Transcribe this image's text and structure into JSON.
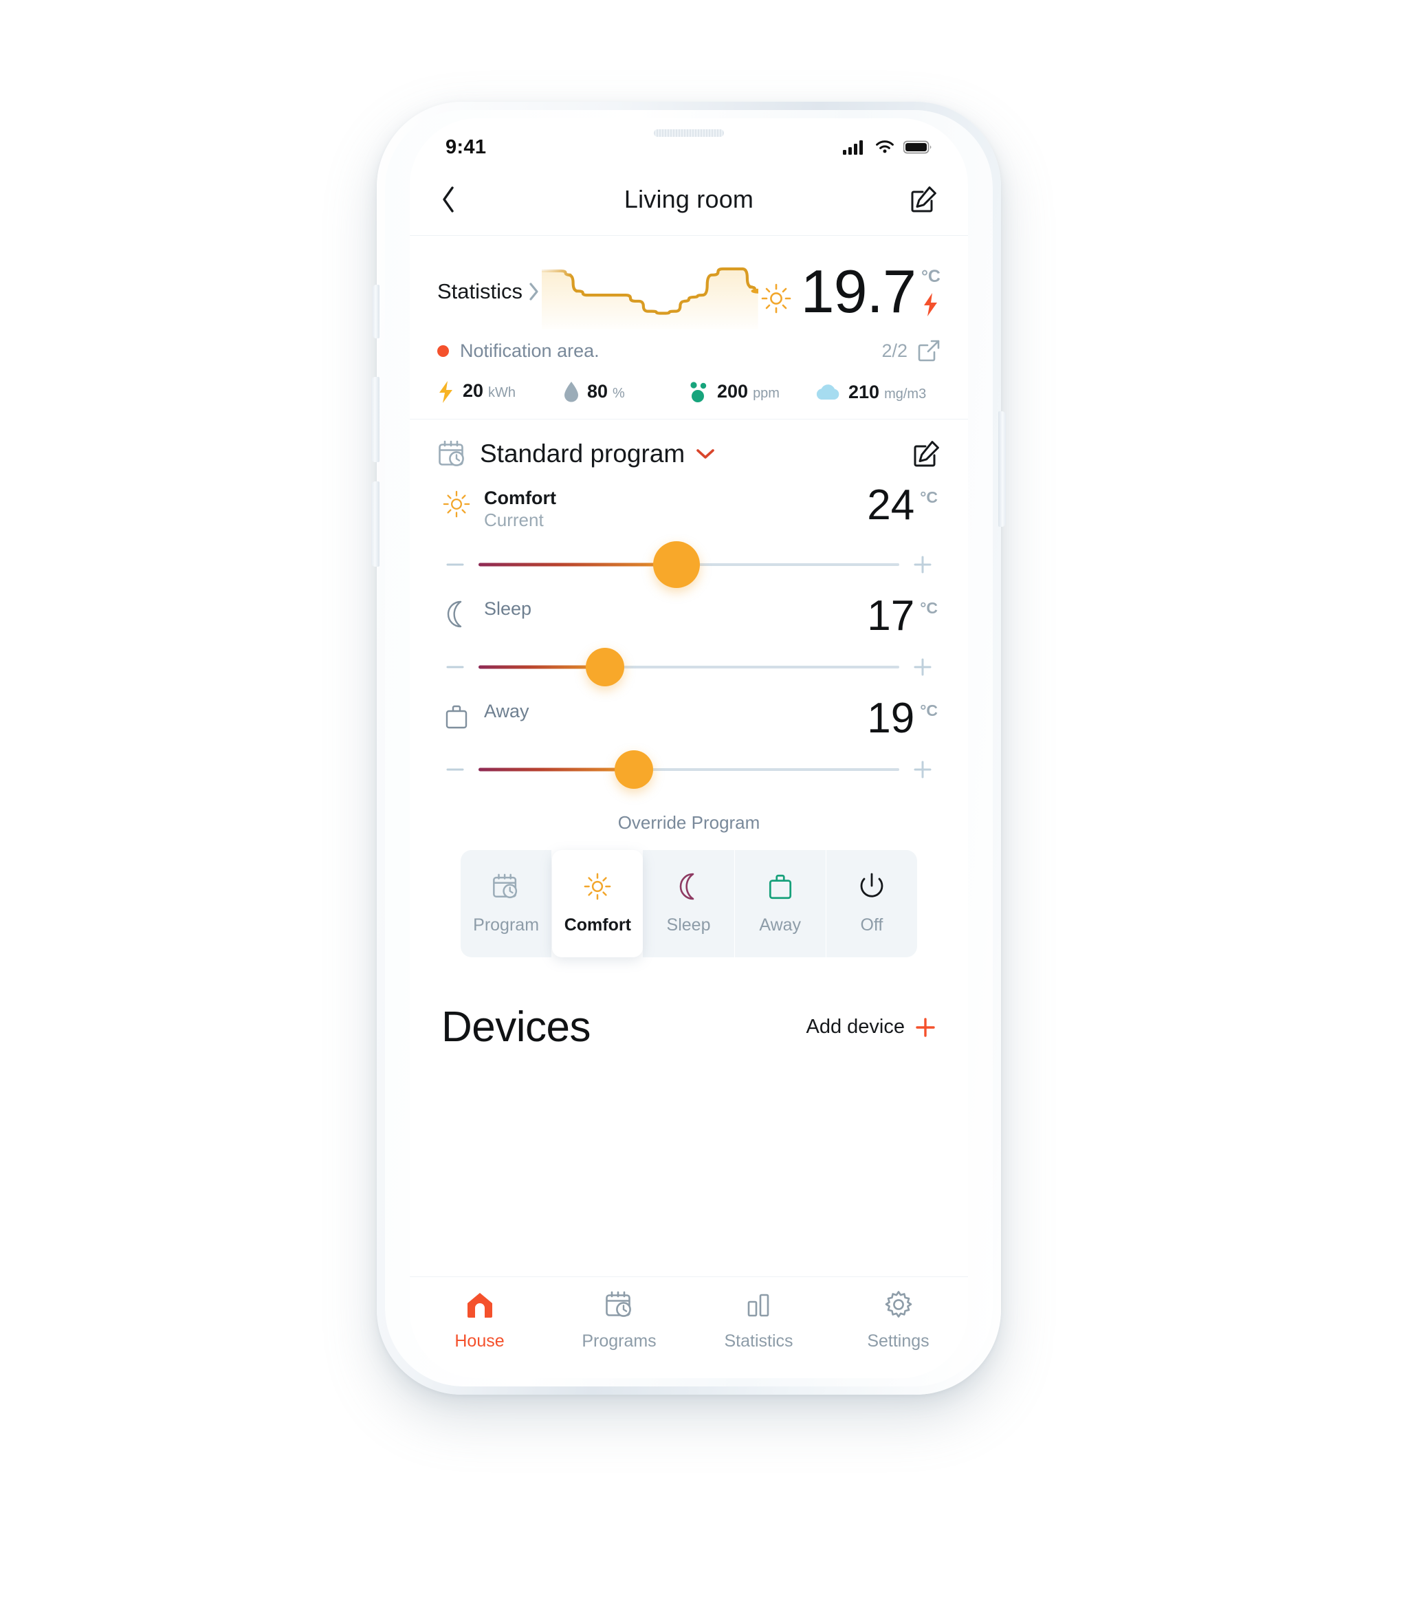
{
  "status_bar": {
    "time": "9:41",
    "cellular_icon": "cellular-signal-icon",
    "wifi_icon": "wifi-icon",
    "battery_icon": "battery-full-icon"
  },
  "header": {
    "back_icon": "chevron-left-icon",
    "title": "Living room",
    "edit_icon": "edit-square-icon"
  },
  "stats_card": {
    "statistics_label": "Statistics",
    "statistics_chevron_icon": "chevron-right-icon",
    "sun_icon": "sun-icon",
    "temperature": "19.7",
    "temperature_unit": "°C",
    "bolt_icon": "lightning-bolt-icon",
    "notification": {
      "dot_color": "#f4512c",
      "text": "Notification area.",
      "count": "2/2",
      "open_icon": "external-link-icon"
    },
    "metrics": [
      {
        "icon": "lightning-bolt-icon",
        "icon_color": "#f7b324",
        "value": "20",
        "unit": "kWh"
      },
      {
        "icon": "water-drop-icon",
        "icon_color": "#9bacb8",
        "value": "80",
        "unit": "%"
      },
      {
        "icon": "co2-molecule-icon",
        "icon_color": "#17a47c",
        "value": "200",
        "unit": "ppm"
      },
      {
        "icon": "cloud-icon",
        "icon_color": "#a6dcf0",
        "value": "210",
        "unit": "mg/m3"
      }
    ]
  },
  "chart_data": {
    "type": "line",
    "title": "",
    "xlabel": "",
    "ylabel": "",
    "grid": false,
    "legend": "none",
    "line_color": "#d99b22",
    "fill_color": "#f6c96a",
    "end_point_color": "#e8a425",
    "x": [
      0,
      4,
      9,
      13,
      16,
      22,
      30,
      38,
      44,
      50,
      56,
      62,
      66,
      70,
      74,
      79,
      84,
      88,
      93,
      97,
      100
    ],
    "y": [
      78,
      78,
      78,
      74,
      58,
      54,
      54,
      54,
      48,
      38,
      36,
      38,
      48,
      52,
      54,
      74,
      80,
      80,
      80,
      62,
      58
    ],
    "ylim": [
      20,
      95
    ],
    "xlim": [
      0,
      100
    ]
  },
  "program": {
    "calendar_icon": "calendar-clock-icon",
    "title": "Standard program",
    "dropdown_icon": "chevron-down-icon",
    "dropdown_color": "#d9452b",
    "edit_icon": "edit-square-icon",
    "modes": [
      {
        "icon": "sun-icon",
        "icon_color": "#f2a62b",
        "name": "Comfort",
        "sub": "Current",
        "temperature": "24",
        "unit": "°C",
        "slider_percent": 47,
        "thumb_size": "large"
      },
      {
        "icon": "moon-icon",
        "icon_color": "#7f8f9d",
        "name": "Sleep",
        "sub": "",
        "temperature": "17",
        "unit": "°C",
        "slider_percent": 30,
        "thumb_size": "small"
      },
      {
        "icon": "briefcase-icon",
        "icon_color": "#7f8f9d",
        "name": "Away",
        "sub": "",
        "temperature": "19",
        "unit": "°C",
        "slider_percent": 37,
        "thumb_size": "small"
      }
    ],
    "override_label": "Override Program",
    "minus_icon": "minus-icon",
    "plus_icon": "plus-icon"
  },
  "override_buttons": [
    {
      "label": "Program",
      "icon": "calendar-clock-icon",
      "icon_color": "#9bacb8",
      "active": false
    },
    {
      "label": "Comfort",
      "icon": "sun-icon",
      "icon_color": "#f2a62b",
      "active": true
    },
    {
      "label": "Sleep",
      "icon": "moon-icon",
      "icon_color": "#8e3a62",
      "active": false
    },
    {
      "label": "Away",
      "icon": "briefcase-icon",
      "icon_color": "#16a07a",
      "active": false
    },
    {
      "label": "Off",
      "icon": "power-icon",
      "icon_color": "#15181b",
      "active": false
    }
  ],
  "devices": {
    "title": "Devices",
    "add_label": "Add device",
    "add_icon": "plus-icon",
    "add_icon_color": "#f4512c"
  },
  "tabbar": {
    "active_color": "#f4512c",
    "inactive_color": "#8d9ca8",
    "items": [
      {
        "label": "House",
        "icon": "home-icon",
        "active": true
      },
      {
        "label": "Programs",
        "icon": "calendar-clock-icon",
        "active": false
      },
      {
        "label": "Statistics",
        "icon": "bar-chart-icon",
        "active": false
      },
      {
        "label": "Settings",
        "icon": "gear-icon",
        "active": false
      }
    ]
  }
}
